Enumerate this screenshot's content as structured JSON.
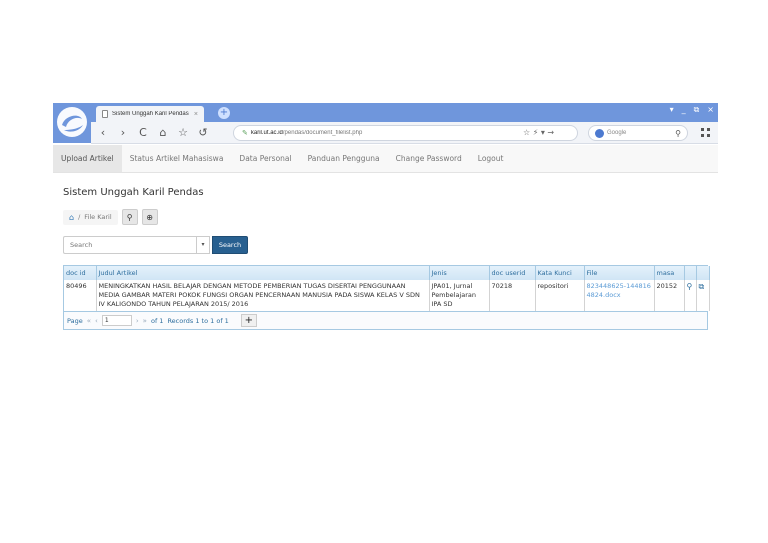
{
  "browser": {
    "tab_title": "Sistem Unggah Karil Pendas",
    "tab_close": "×",
    "new_tab": "+",
    "url_host": "karil.ut.ac.id",
    "url_path": "/pendas/document_filelist.php",
    "search_engine": "Google",
    "nav_back": "‹",
    "nav_forward": "›",
    "nav_reload": "C",
    "nav_home": "⌂",
    "nav_star": "☆",
    "nav_undo": "↺",
    "url_tools": "☆ ⚡ ▾ →",
    "win_controls": [
      "▾",
      "_",
      "⧉",
      "×"
    ]
  },
  "nav": {
    "items": [
      "Upload Artikel",
      "Status Artikel Mahasiswa",
      "Data Personal",
      "Panduan Pengguna",
      "Change Password",
      "Logout"
    ]
  },
  "page": {
    "title": "Sistem Unggah Karil Pendas",
    "breadcrumb": "File Karil",
    "search_placeholder": "Search",
    "search_button": "Search"
  },
  "table": {
    "headers": [
      "doc id",
      "Judul Artikel",
      "Jenis",
      "doc userid",
      "Kata Kunci",
      "File",
      "masa",
      "",
      ""
    ],
    "rows": [
      {
        "doc_id": "80496",
        "judul": "MENINGKATKAN HASIL BELAJAR DENGAN METODE PEMBERIAN TUGAS DISERTAI PENGGUNAAN MEDIA GAMBAR MATERI POKOK FUNGSI ORGAN PENCERNAAN MANUSIA PADA SISWA KELAS V SDN IV KALIGONDO TAHUN PELAJARAN 2015/ 2016",
        "jenis": "JPA01, Jurnal Pembelajaran IPA SD",
        "userid": "70218",
        "kata_kunci": "repositori",
        "file": "823448625-1448164824.docx",
        "masa": "20152"
      }
    ]
  },
  "pager": {
    "page_label": "Page",
    "page_value": "1",
    "of_label": "of 1",
    "records": "Records 1 to 1 of 1",
    "add": "+"
  }
}
